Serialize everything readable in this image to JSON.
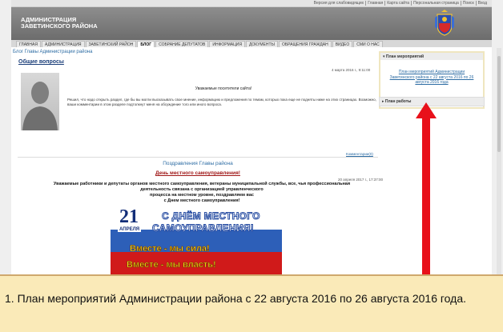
{
  "top_links": [
    "Версия для слабовидящих",
    "Главная",
    "Карта сайта",
    "Персональная страница",
    "Поиск",
    "Вход"
  ],
  "header": {
    "title_line1": "АДМИНИСТРАЦИЯ",
    "title_line2": "ЗАВЕТИНСКОГО РАЙОНА",
    "emblem_icon": "coat-of-arms-icon"
  },
  "nav": [
    {
      "label": "ГЛАВНАЯ"
    },
    {
      "label": "АДМИНИСТРАЦИЯ"
    },
    {
      "label": "ЗАВЕТИНСКИЙ РАЙОН"
    },
    {
      "label": "БЛОГ"
    },
    {
      "label": "СОБРАНИЕ ДЕПУТАТОВ"
    },
    {
      "label": "ИНФОРМАЦИЯ"
    },
    {
      "label": "ДОКУМЕНТЫ"
    },
    {
      "label": "ОБРАЩЕНИЯ ГРАЖДАН"
    },
    {
      "label": "ВИДЕО"
    },
    {
      "label": "СМИ О НАС"
    }
  ],
  "active_nav": "БЛОГ",
  "breadcrumb": "Блог Главы Администрации района",
  "section_title": "Общие вопросы",
  "post1": {
    "date": "4 марта 2016 г., 9:11:00",
    "greeting": "Уважаемые посетители сайта!",
    "body": "Решил, что надо открыть раздел, где бы вы могли высказывать свое мнение, информацию и предложения по темам, которых пока еще не подняты ниже на этих страницах. Возможно, ваши комментарии в этом разделе подтолкнут меня на обсуждение того или иного вопроса.",
    "comments_link": "Комментарии(0)"
  },
  "section2_title": "Поздравления Главы района",
  "post2": {
    "title": "День местного самоуправления!",
    "date": "20 апреля 2017 г., 17:37:00",
    "body_lines": [
      "Уважаемые работники и депутаты органов местного самоуправления, ветераны муниципальной службы, все, чья профессиональная",
      "деятельность связана с организацией управленческого",
      "процесса на местном уровне, поздравляем вас",
      "с Днем местного самоуправления!"
    ]
  },
  "banner": {
    "number": "21",
    "month": "АПРЕЛЯ",
    "line1": "С ДНЁМ МЕСТНОГО",
    "line2": "САМОУПРАВЛЕНИЯ!",
    "slogan1": "Вместе - мы сила!",
    "slogan2": "Вместе - мы власть!"
  },
  "sidebar": {
    "events_header": "План мероприятий",
    "events_link": "План мероприятий Администрации Заветинского района с 22 августа 2016 по 26 августа 2016 года",
    "work_header": "План работы"
  },
  "annotation": {
    "arrow_color": "#e8101a",
    "caption": "1. План мероприятий Администрации района с 22 августа  2016 по 26 августа 2016 года."
  }
}
